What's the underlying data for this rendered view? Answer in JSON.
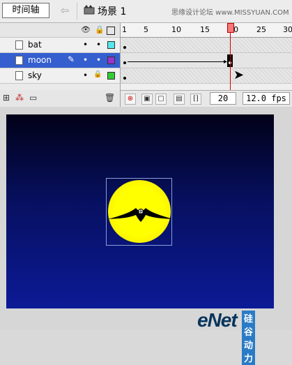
{
  "toolbar": {
    "timeline_label": "时间轴",
    "scene_label": "场景 1",
    "watermark": "思缘设计论坛 www.MISSYUAN.COM"
  },
  "timeline": {
    "ruler_ticks": [
      "1",
      "5",
      "10",
      "15",
      "20",
      "25",
      "30"
    ],
    "layers": [
      {
        "name": "bat",
        "color": "#55e6ee",
        "locked": false,
        "selected": false
      },
      {
        "name": "moon",
        "color": "#9933cc",
        "locked": false,
        "selected": true
      },
      {
        "name": "sky",
        "color": "#33cc33",
        "locked": true,
        "selected": false
      }
    ],
    "current_frame": "20",
    "frame_rate": "12.0 fps"
  },
  "colors": {
    "selection": "#355fcf",
    "playhead": "#d40000",
    "moon": "#ffff00"
  },
  "logo": {
    "text": "eNet",
    "sub": "硅谷动力"
  }
}
